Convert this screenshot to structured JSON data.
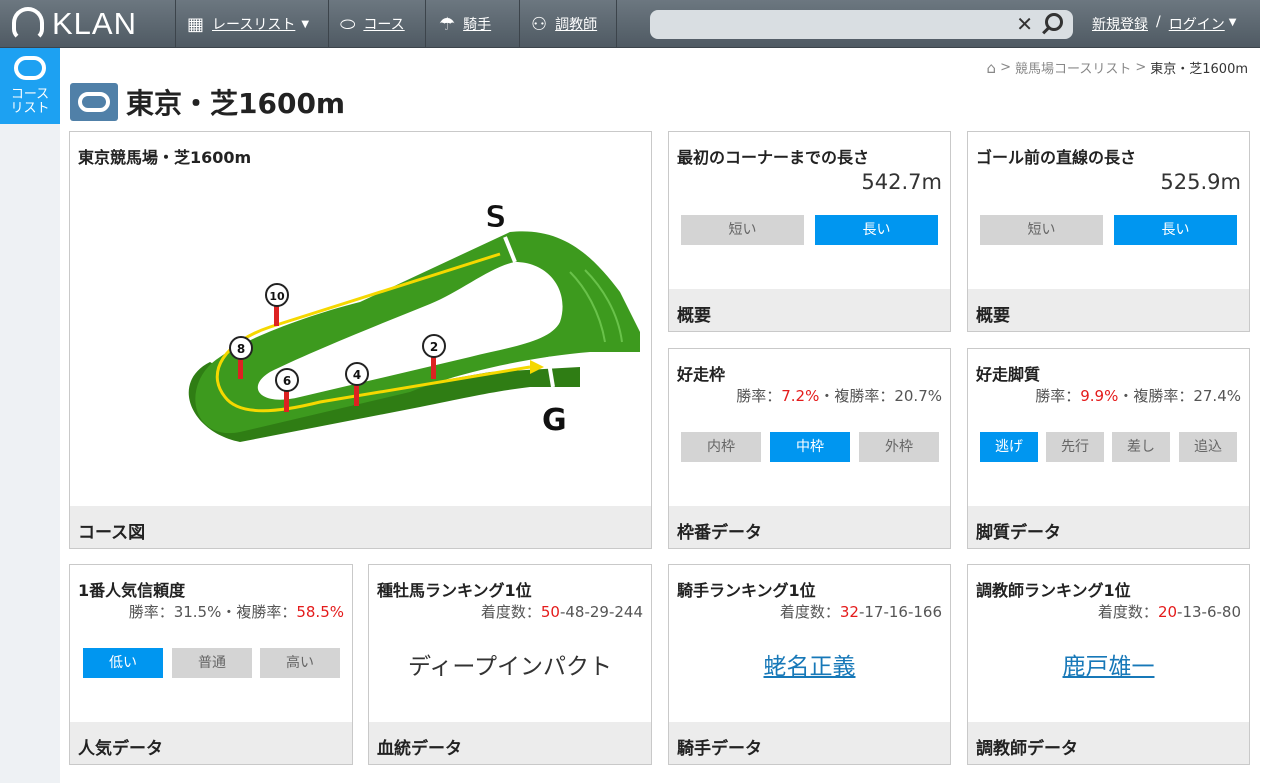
{
  "nav": {
    "logo_text": "KLAN",
    "race_list": "レースリスト",
    "course": "コース",
    "jockey": "騎手",
    "trainer": "調教師",
    "register": "新規登録",
    "separator": "/",
    "login": "ログイン"
  },
  "search": {
    "placeholder": ""
  },
  "sidebar": {
    "course_list": "コース\nリスト"
  },
  "breadcrumb": {
    "parent": "競馬場コースリスト",
    "current": "東京・芝1600m",
    "sep": ">"
  },
  "page": {
    "title": "東京・芝1600m"
  },
  "course_map": {
    "title": "東京競馬場・芝1600m",
    "footer": "コース図",
    "start_label": "S",
    "goal_label": "G",
    "markers": [
      "10",
      "8",
      "6",
      "4",
      "2"
    ]
  },
  "first_corner": {
    "title": "最初のコーナーまでの長さ",
    "value": "542.7m",
    "buttons": [
      "短い",
      "長い"
    ],
    "active": 1,
    "footer": "概要"
  },
  "home_stretch": {
    "title": "ゴール前の直線の長さ",
    "value": "525.9m",
    "buttons": [
      "短い",
      "長い"
    ],
    "active": 1,
    "footer": "概要"
  },
  "post_position": {
    "title": "好走枠",
    "win_label": "勝率：",
    "win_rate": "7.2%",
    "place_label": "・複勝率：20.7%",
    "buttons": [
      "内枠",
      "中枠",
      "外枠"
    ],
    "active": 1,
    "footer": "枠番データ"
  },
  "running_style": {
    "title": "好走脚質",
    "win_label": "勝率：",
    "win_rate": "9.9%",
    "place_label": "・複勝率：27.4%",
    "buttons": [
      "逃げ",
      "先行",
      "差し",
      "追込"
    ],
    "active": 0,
    "footer": "脚質データ"
  },
  "favorite": {
    "title": "1番人気信頼度",
    "win_label": "勝率：31.5%・複勝率：",
    "place_rate": "58.5%",
    "buttons": [
      "低い",
      "普通",
      "高い"
    ],
    "active": 0,
    "footer": "人気データ"
  },
  "sire": {
    "title": "種牡馬ランキング1位",
    "label": "着度数：",
    "wins": "50",
    "rest": "-48-29-244",
    "name": "ディープインパクト",
    "footer": "血統データ"
  },
  "jockey": {
    "title": "騎手ランキング1位",
    "label": "着度数：",
    "wins": "32",
    "rest": "-17-16-166",
    "name": "蛯名正義",
    "footer": "騎手データ"
  },
  "trainer": {
    "title": "調教師ランキング1位",
    "label": "着度数：",
    "wins": "20",
    "rest": "-13-6-80",
    "name": "鹿戸雄一",
    "footer": "調教師データ"
  },
  "colors": {
    "accent": "#0096f0",
    "track_green": "#3d9a1e",
    "highlight_red": "#e41b1b",
    "link": "#1778b8"
  }
}
